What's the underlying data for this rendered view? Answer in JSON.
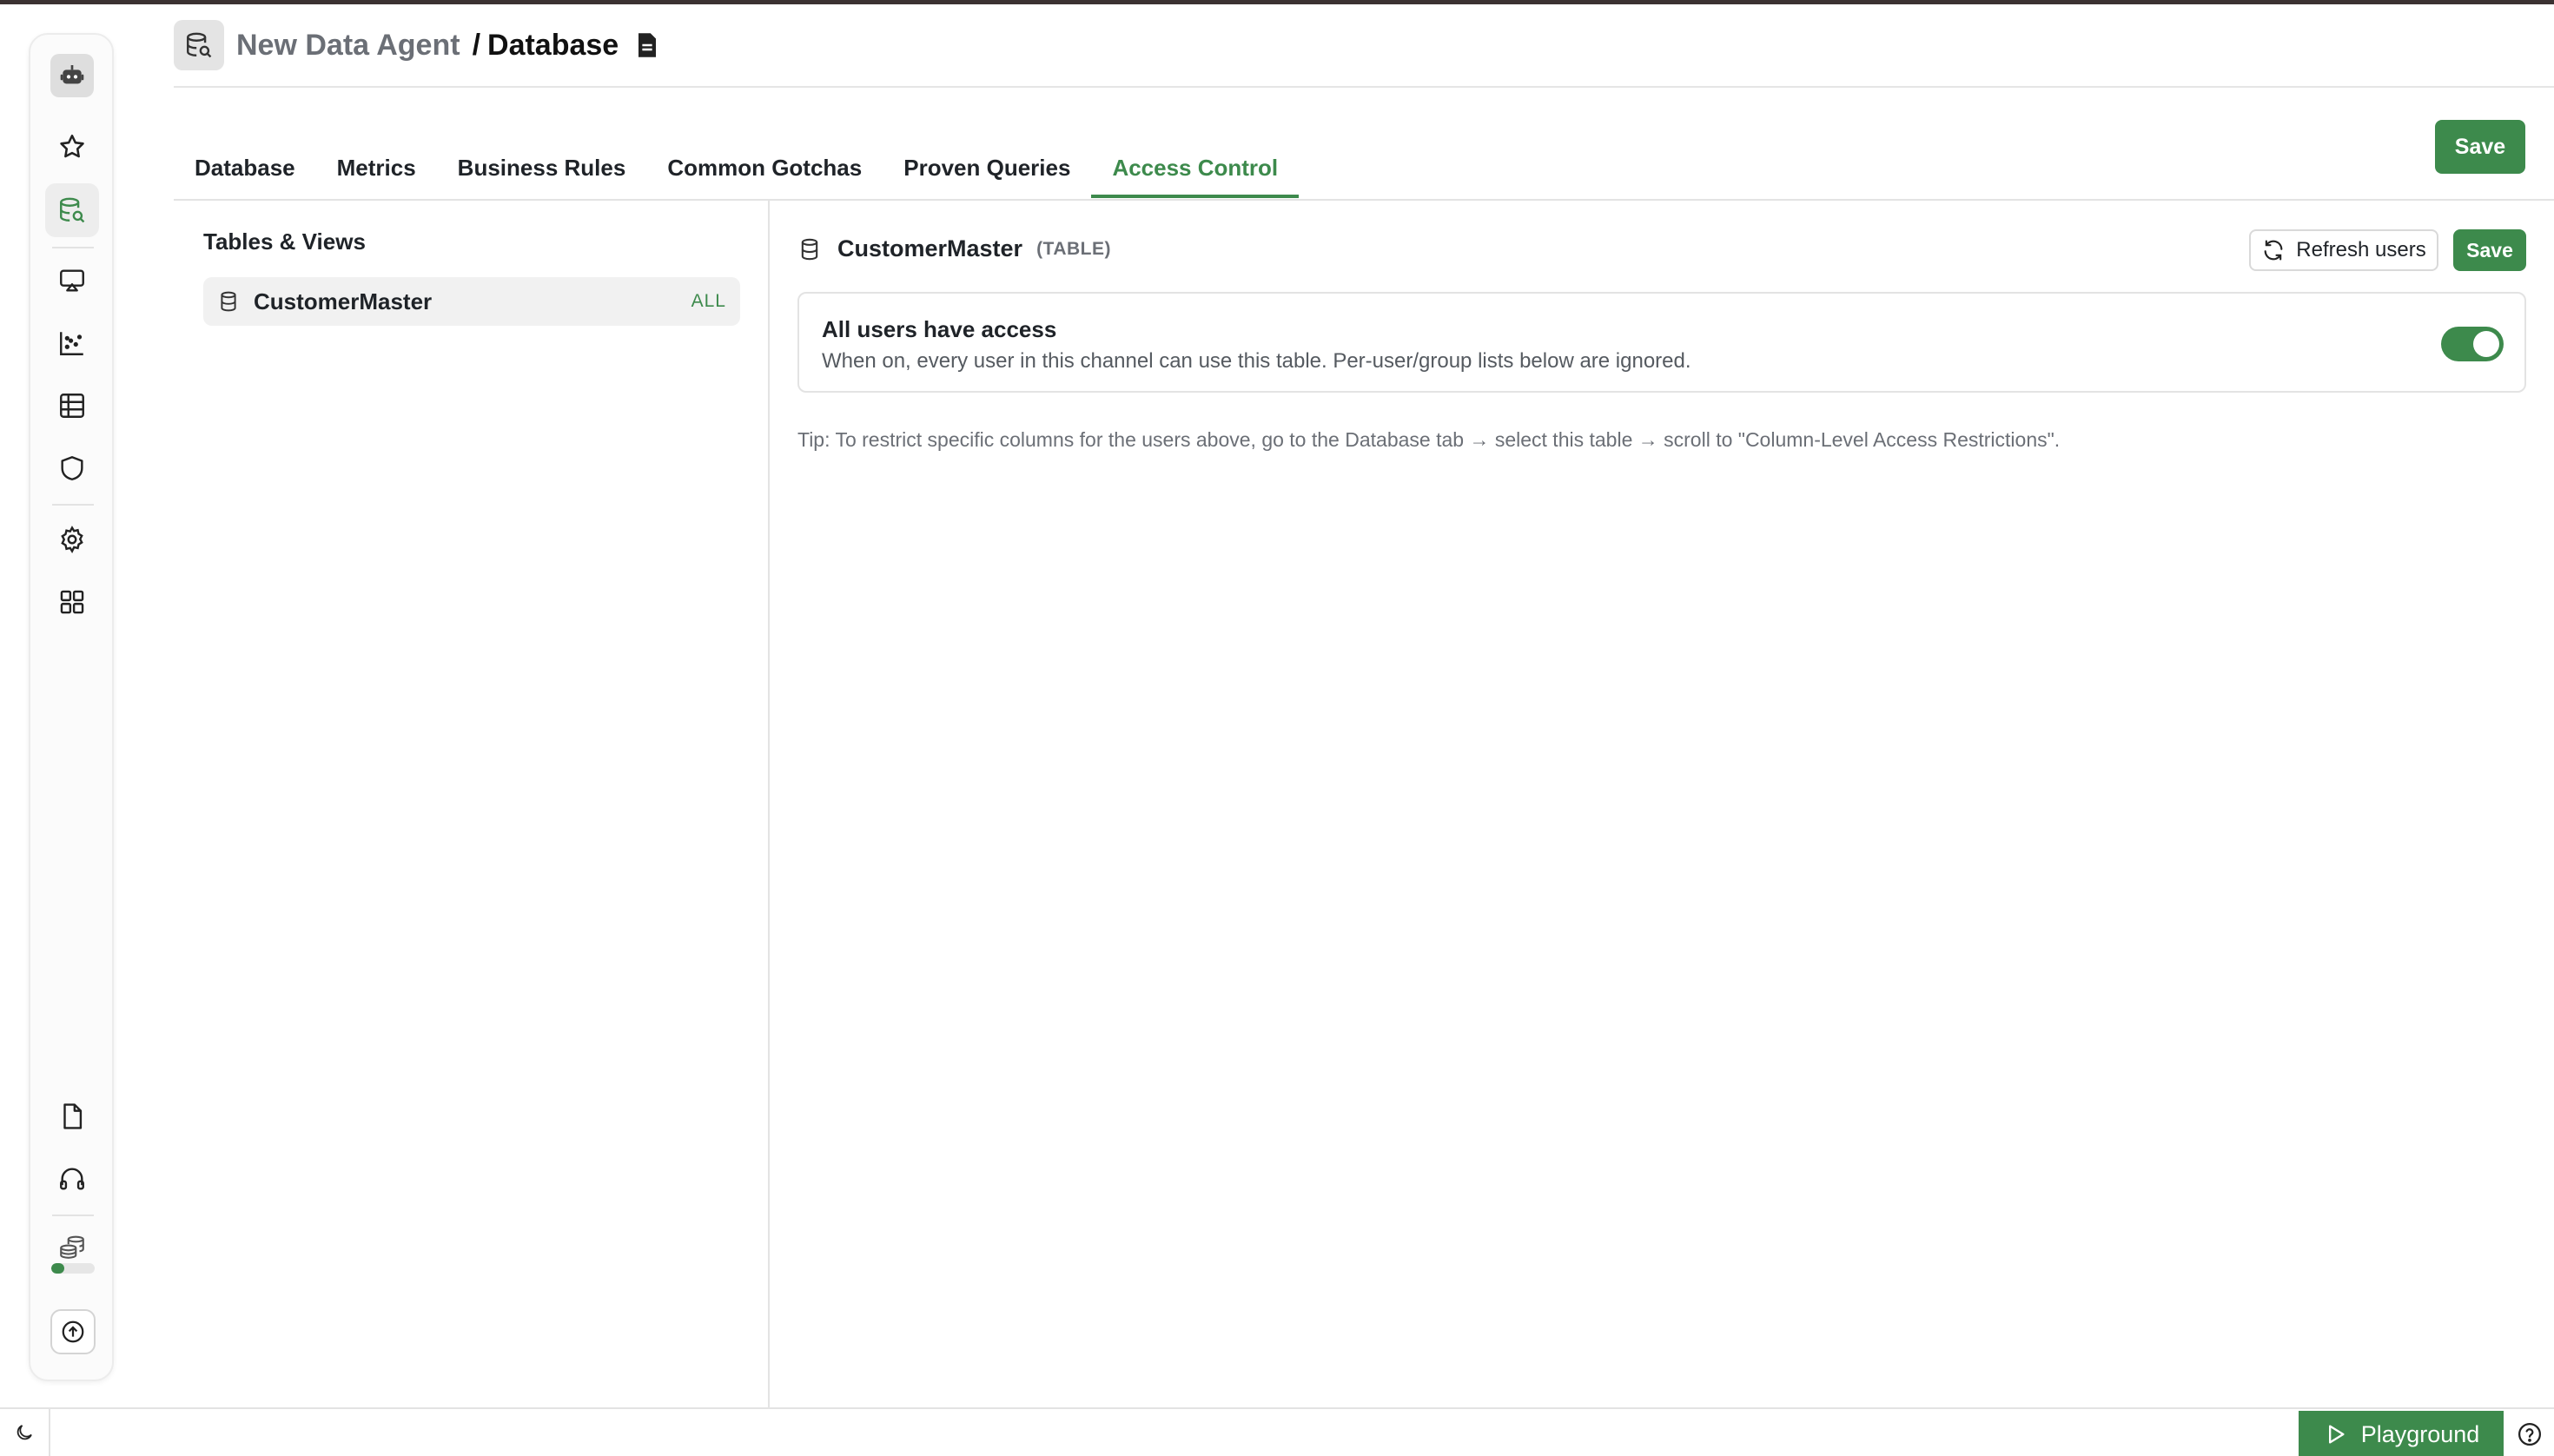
{
  "header": {
    "parent": "New Data Agent",
    "separator": "/",
    "current": "Database"
  },
  "tabs": [
    {
      "label": "Database"
    },
    {
      "label": "Metrics"
    },
    {
      "label": "Business Rules"
    },
    {
      "label": "Common Gotchas"
    },
    {
      "label": "Proven Queries"
    },
    {
      "label": "Access Control",
      "active": true
    }
  ],
  "save_label": "Save",
  "left_panel": {
    "title": "Tables & Views",
    "items": [
      {
        "name": "CustomerMaster",
        "badge": "ALL"
      }
    ]
  },
  "detail": {
    "title": "CustomerMaster",
    "type": "(TABLE)",
    "refresh_label": "Refresh users",
    "save_label": "Save",
    "access": {
      "title": "All users have access",
      "description": "When on, every user in this channel can use this table. Per-user/group lists below are ignored.",
      "enabled": true
    },
    "tip": "Tip: To restrict specific columns for the users above, go to the Database tab → select this table → scroll to \"Column-Level Access Restrictions\"."
  },
  "bottom": {
    "playground_label": "Playground"
  },
  "rail": {
    "icons": [
      "bot-icon",
      "star-icon",
      "database-search-icon",
      "cast-icon",
      "scatter-chart-icon",
      "table-icon",
      "shield-icon",
      "gear-icon",
      "grid-icon",
      "document-icon",
      "headphones-icon",
      "coins-icon",
      "upload-icon"
    ],
    "credits_fraction": 0.3
  },
  "colors": {
    "accent": "#3d8a4c",
    "text": "#1f2328",
    "muted": "#6b6f76"
  }
}
